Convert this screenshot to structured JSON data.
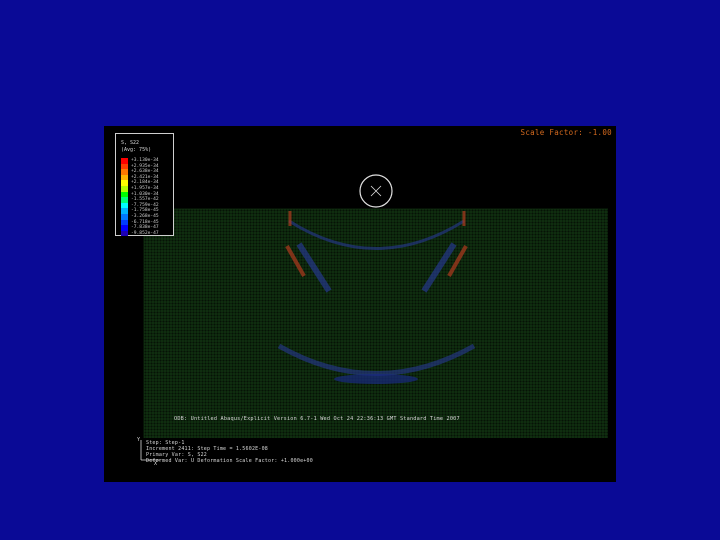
{
  "viewport": {
    "scale_factor_text": "Scale Factor: -1.00",
    "background_color": "#000000",
    "slide_background": "#0a0a96"
  },
  "legend": {
    "variable": "S, S22",
    "averaging": "(Avg: 75%)",
    "colors": [
      "#ff0000",
      "#ff3c00",
      "#ff7800",
      "#ffb400",
      "#ffff00",
      "#b4ff00",
      "#00ff00",
      "#00ff78",
      "#00ffff",
      "#00b4ff",
      "#0078ff",
      "#003cff",
      "#0000ff",
      "#1e00b4"
    ],
    "labels": [
      "+3.130e-34",
      "+2.935e-34",
      "+2.638e-34",
      "+2.421e-34",
      "+2.184e-34",
      "+1.957e-34",
      "+1.030e-34",
      "-1.557e-42",
      "-7.759e-42",
      "-1.758e-45",
      "-3.268e-45",
      "-6.718e-45",
      "-7.838e-47",
      "-9.852e-47"
    ]
  },
  "mesh": {
    "grid_color": "#1f5a1f",
    "stress_colors": [
      "#b03a20",
      "#2a3aa0",
      "#1a2a80"
    ]
  },
  "annotations": {
    "odb_line": "ODB: Untitled   Abaqus/Explicit Version 6.7-1   Wed Oct 24 22:36:13 GMT Standard Time 2007",
    "step_line": "Step: Step-1",
    "increment_line": "Increment      2411: Step Time =    1.5602E-08",
    "primary_var_line": "Primary Var: S, S22",
    "deformed_var_line": "Deformed Var: U  Deformation Scale Factor: +1.000e+00"
  },
  "triad": {
    "y_label": "Y",
    "x_label": "X"
  }
}
